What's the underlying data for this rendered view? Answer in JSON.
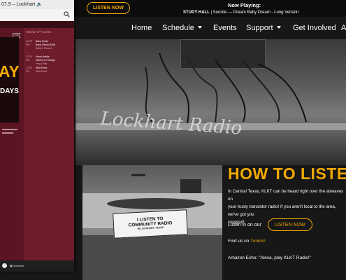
{
  "header": {
    "listen_button": "LISTEN NOW",
    "now_playing_label": "Now Playing:",
    "now_playing_show": "STUDY HALL",
    "now_playing_sep": " | Suicide  —  ",
    "now_playing_song": "Dream Baby Dream - Long Version"
  },
  "nav": {
    "items": [
      "Home",
      "Schedule",
      "Events",
      "Support",
      "Get Involved",
      "A"
    ]
  },
  "hero": {
    "sign_text": "Lockhart Radio"
  },
  "photo": {
    "sign_lines": [
      "I LISTEN TO",
      "COMMUNITY RADIO",
      "IN LOCKHART, TEXAS"
    ]
  },
  "how_to_listen": {
    "title": "HOW TO LISTEN",
    "body_1": "In Central Texas, KLKT can be heard right over the airwaves on",
    "body_2": "your trusty transistor radio! If you aren't local to the area, we've got you",
    "body_3": "covered!",
    "listen_label": "Listen in on our",
    "listen_button": "LISTEN NOW",
    "findus_label": "Find us on ",
    "findus_link": "TuneIn!",
    "alexa_text": "Amazon Echo: \"Alexa, play KLKT Radio!\""
  },
  "popup": {
    "window_title": "07.9 – Lockhart 🔈",
    "live_tag": "LIVE",
    "art_big": "AY",
    "art_small": "DAYS",
    "recently_played_label": "RECENTLY PLAYED",
    "tracks": [
      {
        "time": "12:30 PM",
        "title": "Baby Budd",
        "line2": "Baby (Radio Edit)",
        "line3": "Baby's Pounce"
      },
      {
        "time": "12:24 PM",
        "title": "Hand Habits",
        "line2": "Wheel of Change",
        "line3": "Meg Duffy"
      },
      {
        "time": "12:20 PM",
        "title": "Wild Rose",
        "line2": "I Remember You",
        "line3": "Wild Rose"
      }
    ],
    "bottom_label": "Schedule",
    "colors": {
      "panel": "#6e1b2b",
      "accent": "#f2a900"
    }
  }
}
